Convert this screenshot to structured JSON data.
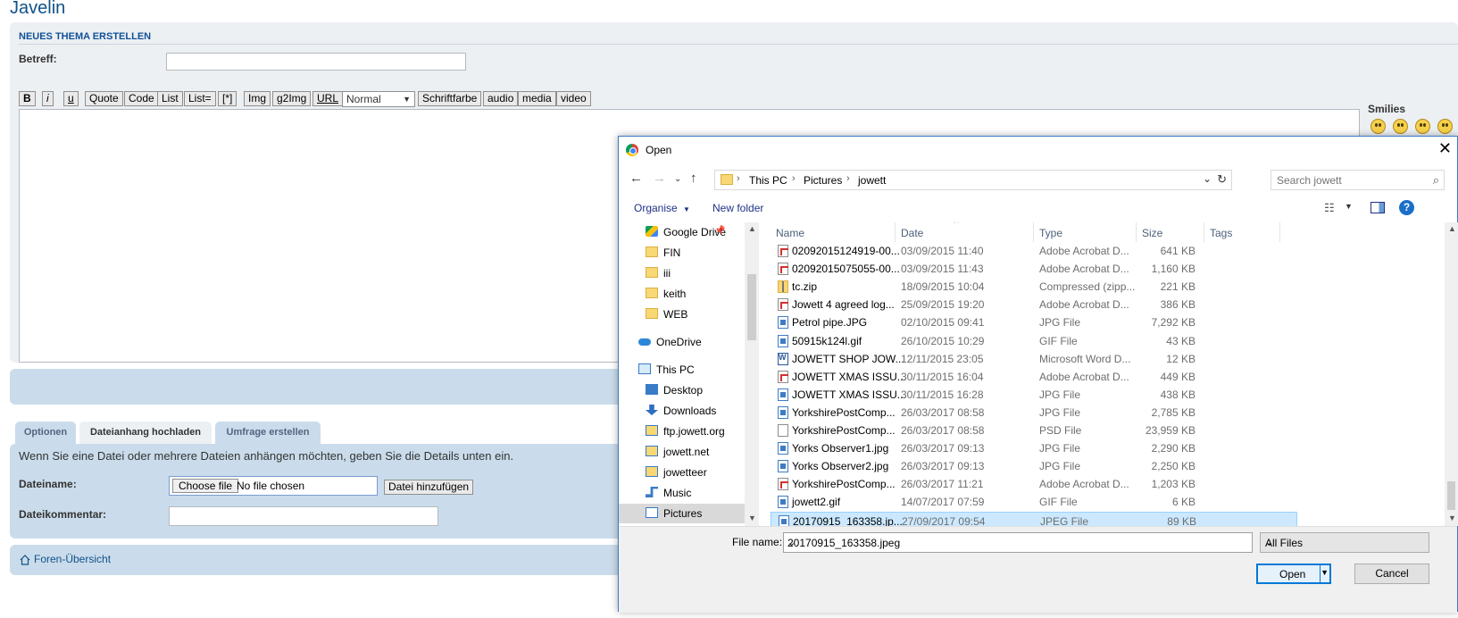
{
  "forum": {
    "site_title": "Javelin",
    "panel_header": "NEUES THEMA ERSTELLEN",
    "subject_label": "Betreff:",
    "toolbar": {
      "bold": "B",
      "italic": "i",
      "underline": "u",
      "quote": "Quote",
      "code": "Code",
      "list": "List",
      "list_eq": "List=",
      "list_item": "[*]",
      "img": "Img",
      "g2img": "g2Img",
      "url": "URL",
      "font_size": "Normal",
      "font_color": "Schriftfarbe",
      "audio": "audio",
      "media": "media",
      "video": "video"
    },
    "smilies_label": "Smilies",
    "tabs": [
      {
        "label": "Optionen",
        "active": false
      },
      {
        "label": "Dateianhang hochladen",
        "active": true
      },
      {
        "label": "Umfrage erstellen",
        "active": false
      }
    ],
    "attach": {
      "hint": "Wenn Sie eine Datei oder mehrere Dateien anhängen möchten, geben Sie die Details unten ein.",
      "filename_label": "Dateiname:",
      "choose_file": "Choose file",
      "no_file": "No file chosen",
      "add_file": "Datei hinzufügen",
      "comment_label": "Dateikommentar:"
    },
    "forum_index_link": "Foren-Übersicht"
  },
  "dialog": {
    "title": "Open",
    "close_icon": "close-icon",
    "breadcrumb": [
      "This PC",
      "Pictures",
      "jowett"
    ],
    "search_placeholder": "Search jowett",
    "organise": "Organise",
    "new_folder": "New folder",
    "help": "?",
    "nav_items": [
      {
        "label": "Google Drive",
        "icon": "google-drive-icon",
        "indent": 2,
        "pinned": true
      },
      {
        "label": "FIN",
        "icon": "folder-icon",
        "indent": 2
      },
      {
        "label": "iii",
        "icon": "folder-icon",
        "indent": 2
      },
      {
        "label": "keith",
        "icon": "folder-icon",
        "indent": 2
      },
      {
        "label": "WEB",
        "icon": "folder-icon",
        "indent": 2
      },
      {
        "label": "OneDrive",
        "icon": "onedrive-icon",
        "indent": 1
      },
      {
        "label": "This PC",
        "icon": "this-pc-icon",
        "indent": 1
      },
      {
        "label": "Desktop",
        "icon": "desktop-icon",
        "indent": 2
      },
      {
        "label": "Downloads",
        "icon": "downloads-icon",
        "indent": 2
      },
      {
        "label": "ftp.jowett.org",
        "icon": "network-folder-icon",
        "indent": 2
      },
      {
        "label": "jowett.net",
        "icon": "network-folder-icon",
        "indent": 2
      },
      {
        "label": "jowetteer",
        "icon": "network-folder-icon",
        "indent": 2
      },
      {
        "label": "Music",
        "icon": "music-icon",
        "indent": 2
      },
      {
        "label": "Pictures",
        "icon": "pictures-icon",
        "indent": 2,
        "selected": true
      }
    ],
    "columns": [
      "Name",
      "Date",
      "Type",
      "Size",
      "Tags"
    ],
    "files": [
      {
        "name": "02092015124919-00...",
        "date": "03/09/2015 11:40",
        "type": "Adobe Acrobat D...",
        "size": "641 KB",
        "icon": "pdf"
      },
      {
        "name": "02092015075055-00...",
        "date": "03/09/2015 11:43",
        "type": "Adobe Acrobat D...",
        "size": "1,160 KB",
        "icon": "pdf"
      },
      {
        "name": "tc.zip",
        "date": "18/09/2015 10:04",
        "type": "Compressed (zipp...",
        "size": "221 KB",
        "icon": "zip"
      },
      {
        "name": "Jowett 4 agreed log...",
        "date": "25/09/2015 19:20",
        "type": "Adobe Acrobat D...",
        "size": "386 KB",
        "icon": "pdf"
      },
      {
        "name": "Petrol pipe.JPG",
        "date": "02/10/2015 09:41",
        "type": "JPG File",
        "size": "7,292 KB",
        "icon": "img"
      },
      {
        "name": "50915k124l.gif",
        "date": "26/10/2015 10:29",
        "type": "GIF File",
        "size": "43 KB",
        "icon": "img"
      },
      {
        "name": "JOWETT SHOP JOW...",
        "date": "12/11/2015 23:05",
        "type": "Microsoft Word D...",
        "size": "12 KB",
        "icon": "doc"
      },
      {
        "name": "JOWETT XMAS ISSU...",
        "date": "30/11/2015 16:04",
        "type": "Adobe Acrobat D...",
        "size": "449 KB",
        "icon": "pdf"
      },
      {
        "name": "JOWETT XMAS ISSU...",
        "date": "30/11/2015 16:28",
        "type": "JPG File",
        "size": "438 KB",
        "icon": "img"
      },
      {
        "name": "YorkshirePostComp...",
        "date": "26/03/2017 08:58",
        "type": "JPG File",
        "size": "2,785 KB",
        "icon": "img"
      },
      {
        "name": "YorkshirePostComp...",
        "date": "26/03/2017 08:58",
        "type": "PSD File",
        "size": "23,959 KB",
        "icon": "blank"
      },
      {
        "name": "Yorks Observer1.jpg",
        "date": "26/03/2017 09:13",
        "type": "JPG File",
        "size": "2,290 KB",
        "icon": "img"
      },
      {
        "name": "Yorks Observer2.jpg",
        "date": "26/03/2017 09:13",
        "type": "JPG File",
        "size": "2,250 KB",
        "icon": "img"
      },
      {
        "name": "YorkshirePostComp...",
        "date": "26/03/2017 11:21",
        "type": "Adobe Acrobat D...",
        "size": "1,203 KB",
        "icon": "pdf"
      },
      {
        "name": "jowett2.gif",
        "date": "14/07/2017 07:59",
        "type": "GIF File",
        "size": "6 KB",
        "icon": "img"
      },
      {
        "name": "20170915_163358.jp...",
        "date": "27/09/2017 09:54",
        "type": "JPEG File",
        "size": "89 KB",
        "icon": "img",
        "selected": true
      }
    ],
    "filename_label": "File name:",
    "filename_value": "20170915_163358.jpeg",
    "filter": "All Files",
    "open": "Open",
    "cancel": "Cancel"
  }
}
